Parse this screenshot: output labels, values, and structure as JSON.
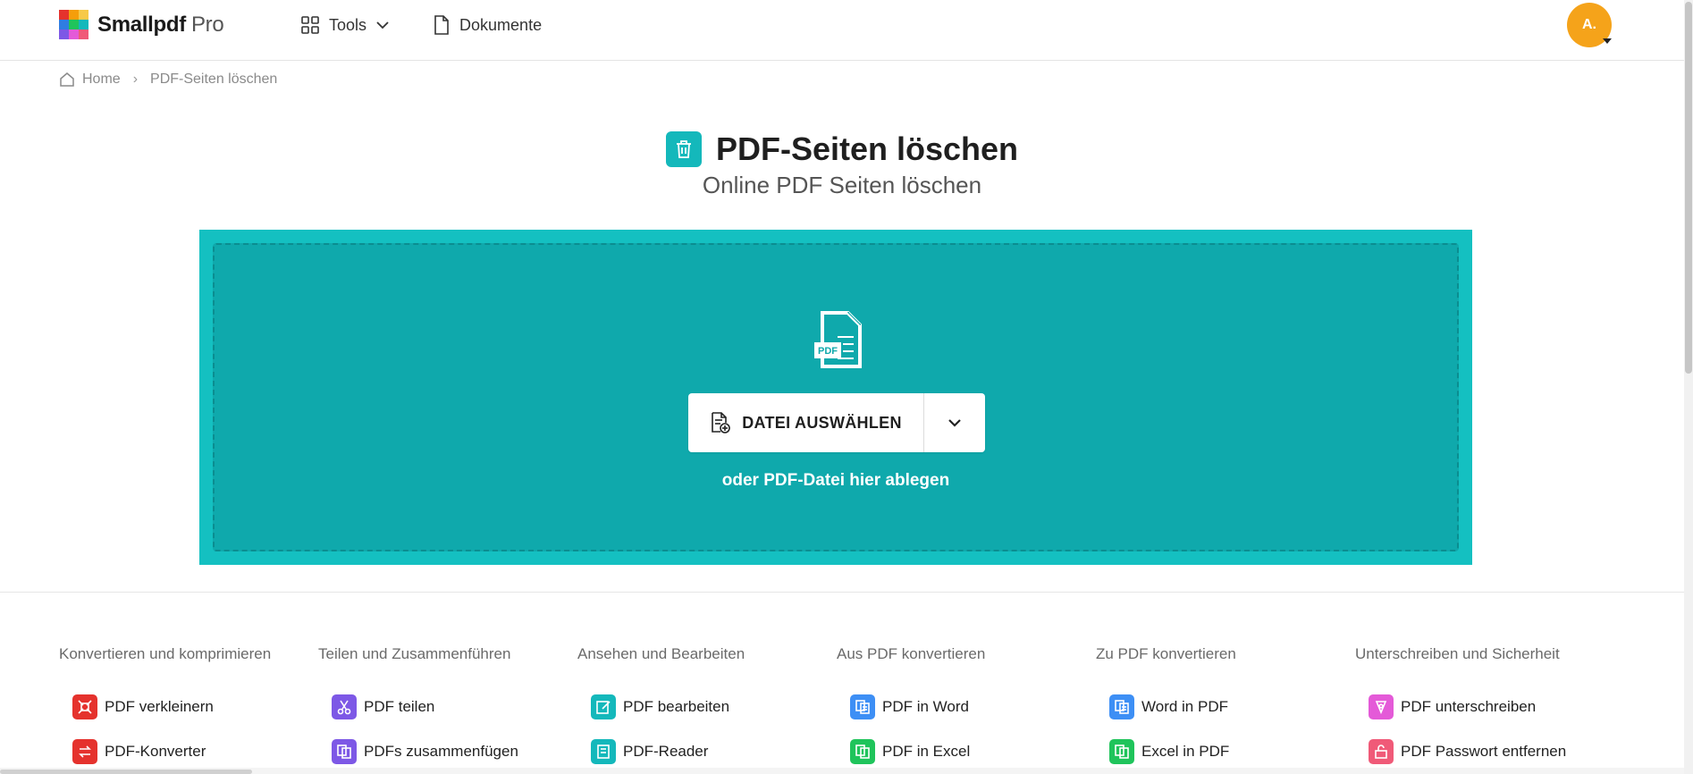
{
  "header": {
    "logo_text": "Smallpdf",
    "logo_suffix": "Pro",
    "nav": [
      {
        "label": "Tools"
      },
      {
        "label": "Dokumente"
      }
    ],
    "avatar_initials": "A."
  },
  "breadcrumb": {
    "home": "Home",
    "separator": "›",
    "current": "PDF-Seiten löschen"
  },
  "page": {
    "title": "PDF-Seiten löschen",
    "subtitle": "Online PDF Seiten löschen"
  },
  "dropzone": {
    "file_badge": "PDF",
    "select_label": "DATEI AUSWÄHLEN",
    "hint": "oder PDF-Datei hier ablegen"
  },
  "categories": [
    {
      "title": "Konvertieren und komprimieren",
      "items": [
        {
          "label": "PDF verkleinern",
          "color": "#e5322d",
          "icon": "compress-icon"
        },
        {
          "label": "PDF-Konverter",
          "color": "#e5322d",
          "icon": "convert-icon"
        }
      ]
    },
    {
      "title": "Teilen und Zusammenführen",
      "items": [
        {
          "label": "PDF teilen",
          "color": "#7d58e6",
          "icon": "scissors-icon"
        },
        {
          "label": "PDFs zusammenfügen",
          "color": "#7d58e6",
          "icon": "merge-icon"
        }
      ]
    },
    {
      "title": "Ansehen und Bearbeiten",
      "items": [
        {
          "label": "PDF bearbeiten",
          "color": "#14b8bb",
          "icon": "edit-icon"
        },
        {
          "label": "PDF-Reader",
          "color": "#14b8bb",
          "icon": "reader-icon"
        }
      ]
    },
    {
      "title": "Aus PDF konvertieren",
      "items": [
        {
          "label": "PDF in Word",
          "color": "#3d8ff5",
          "icon": "word-icon"
        },
        {
          "label": "PDF in Excel",
          "color": "#1fc45b",
          "icon": "excel-icon"
        }
      ]
    },
    {
      "title": "Zu PDF konvertieren",
      "items": [
        {
          "label": "Word in PDF",
          "color": "#3d8ff5",
          "icon": "word-icon"
        },
        {
          "label": "Excel in PDF",
          "color": "#1fc45b",
          "icon": "excel-icon"
        }
      ]
    },
    {
      "title": "Unterschreiben und Sicherheit",
      "items": [
        {
          "label": "PDF unterschreiben",
          "color": "#e45ad8",
          "icon": "sign-icon"
        },
        {
          "label": "PDF Passwort entfernen",
          "color": "#f05a78",
          "icon": "unlock-icon"
        }
      ]
    }
  ],
  "colors": {
    "brand_teal": "#14c0c1",
    "drop_inner": "#0fa9ac",
    "avatar": "#f5a31a"
  }
}
